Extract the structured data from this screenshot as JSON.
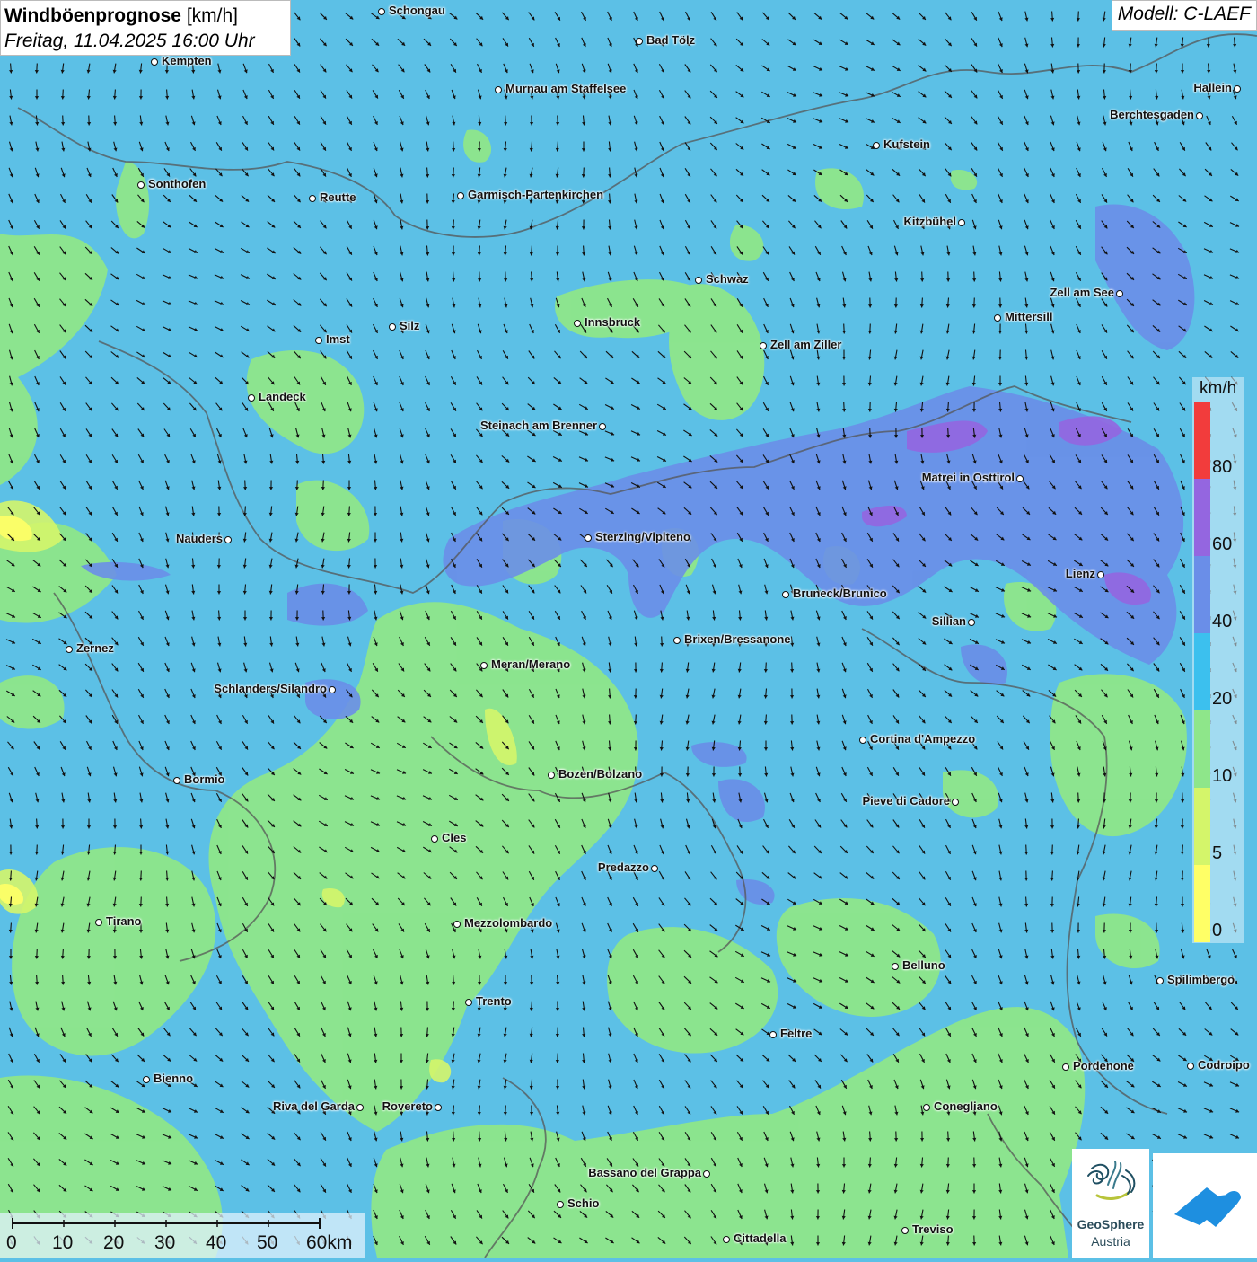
{
  "title": {
    "main_bold": "Windböenprognose",
    "main_unit": "[km/h]",
    "datetime": "Freitag, 11.04.2025 16:00 Uhr"
  },
  "model": "Modell: C-LAEF",
  "colors": {
    "c0": "#ffff66",
    "c5": "#d4f56a",
    "c10": "#8ee68a",
    "c20": "#5cc0e6",
    "c40": "#6a8ee8",
    "c60": "#9466e0",
    "c80": "#f23c3c"
  },
  "legend": {
    "unit": "km/h",
    "ticks": [
      "80",
      "60",
      "40",
      "20",
      "10",
      "5",
      "0"
    ]
  },
  "scale_bar": {
    "labels": [
      "0",
      "10",
      "20",
      "30",
      "40",
      "50",
      "60km"
    ]
  },
  "logos": {
    "geosphere_line1": "GeoSphere",
    "geosphere_line2": "Austria"
  },
  "cities": [
    {
      "name": "Schongau",
      "side": "right"
    },
    {
      "name": "Bad Tölz",
      "side": "right"
    },
    {
      "name": "Kempten",
      "side": "right"
    },
    {
      "name": "Murnau am Staffelsee",
      "side": "right"
    },
    {
      "name": "Hallein",
      "side": "left"
    },
    {
      "name": "Berchtesgaden",
      "side": "left"
    },
    {
      "name": "Kufstein",
      "side": "right"
    },
    {
      "name": "Sonthofen",
      "side": "right"
    },
    {
      "name": "Reutte",
      "side": "right"
    },
    {
      "name": "Garmisch-Partenkirchen",
      "side": "right"
    },
    {
      "name": "Kitzbühel",
      "side": "left"
    },
    {
      "name": "Schwaz",
      "side": "right"
    },
    {
      "name": "Zell am See",
      "side": "left"
    },
    {
      "name": "Innsbruck",
      "side": "right"
    },
    {
      "name": "Mittersill",
      "side": "right"
    },
    {
      "name": "Imst",
      "side": "right"
    },
    {
      "name": "Silz",
      "side": "right"
    },
    {
      "name": "Zell am Ziller",
      "side": "right"
    },
    {
      "name": "Landeck",
      "side": "right"
    },
    {
      "name": "Steinach am Brenner",
      "side": "left"
    },
    {
      "name": "Matrei in Osttirol",
      "side": "left"
    },
    {
      "name": "Nauders",
      "side": "left"
    },
    {
      "name": "Sterzing/Vipiteno",
      "side": "right"
    },
    {
      "name": "Lienz",
      "side": "left"
    },
    {
      "name": "Bruneck/Brunico",
      "side": "right"
    },
    {
      "name": "Sillian",
      "side": "left"
    },
    {
      "name": "Zernez",
      "side": "right"
    },
    {
      "name": "Brixen/Bressanone",
      "side": "right"
    },
    {
      "name": "Meran/Merano",
      "side": "right"
    },
    {
      "name": "Schlanders/Silandro",
      "side": "left"
    },
    {
      "name": "Cortina d'Ampezzo",
      "side": "right"
    },
    {
      "name": "Bozen/Bolzano",
      "side": "right"
    },
    {
      "name": "Bormio",
      "side": "right"
    },
    {
      "name": "Pieve di Cadore",
      "side": "left"
    },
    {
      "name": "Cles",
      "side": "right"
    },
    {
      "name": "Predazzo",
      "side": "left"
    },
    {
      "name": "Tirano",
      "side": "right"
    },
    {
      "name": "Mezzolombardo",
      "side": "right"
    },
    {
      "name": "Belluno",
      "side": "right"
    },
    {
      "name": "Spilimbergo",
      "side": "right"
    },
    {
      "name": "Trento",
      "side": "right"
    },
    {
      "name": "Feltre",
      "side": "right"
    },
    {
      "name": "Pordenone",
      "side": "right"
    },
    {
      "name": "Codroipo",
      "side": "right"
    },
    {
      "name": "Bienno",
      "side": "right"
    },
    {
      "name": "Riva del Garda",
      "side": "left"
    },
    {
      "name": "Rovereto",
      "side": "left"
    },
    {
      "name": "Conegliano",
      "side": "right"
    },
    {
      "name": "Bassano del Grappa",
      "side": "left"
    },
    {
      "name": "Schio",
      "side": "right"
    },
    {
      "name": "Treviso",
      "side": "right"
    },
    {
      "name": "Cittadella",
      "side": "right"
    }
  ]
}
